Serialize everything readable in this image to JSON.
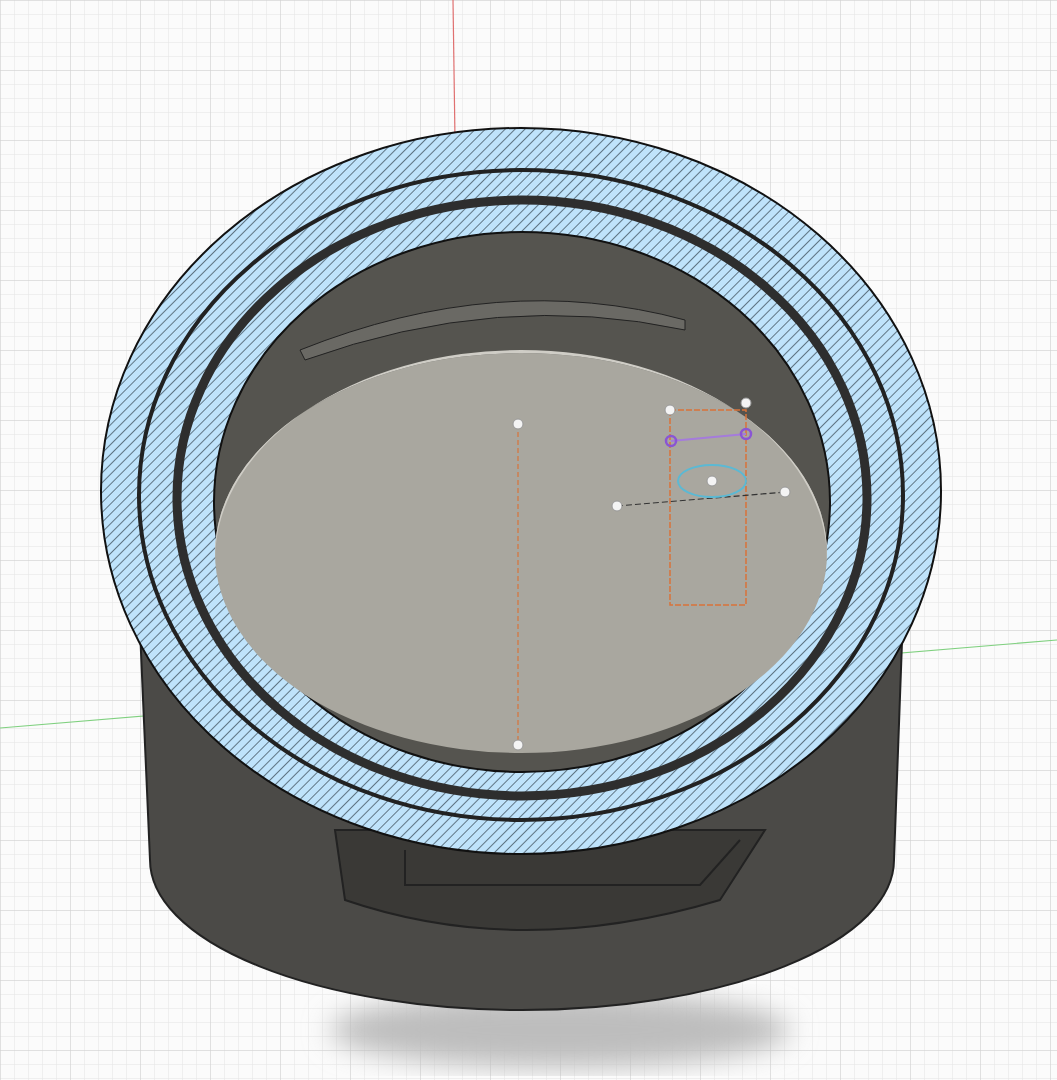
{
  "viewport": {
    "grid": true,
    "section_hatching": true
  }
}
